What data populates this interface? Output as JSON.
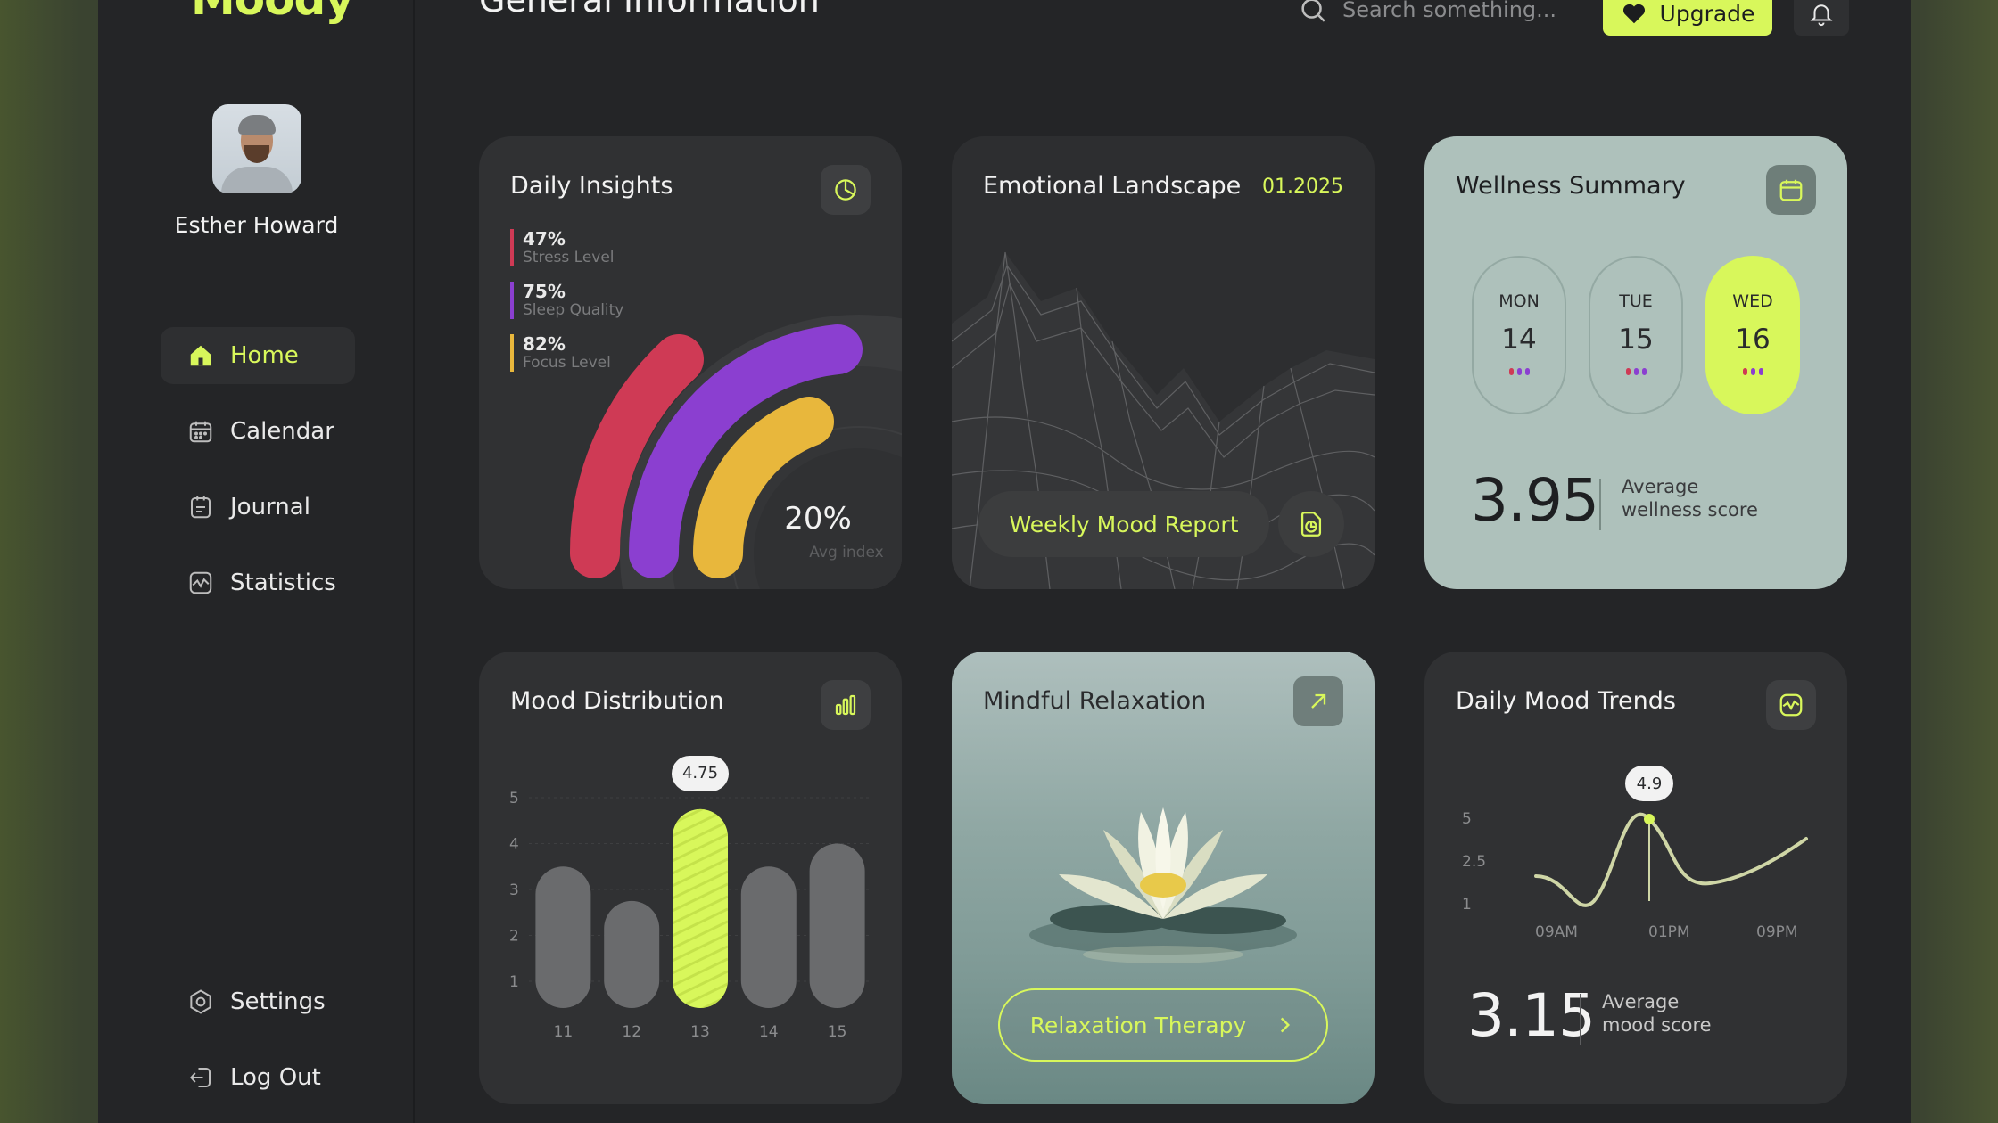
{
  "app": {
    "logo": "Moody",
    "page_title": "General Information"
  },
  "user": {
    "name": "Esther Howard"
  },
  "sidebar": {
    "items": [
      {
        "label": "Home",
        "icon": "home-icon"
      },
      {
        "label": "Calendar",
        "icon": "calendar-icon"
      },
      {
        "label": "Journal",
        "icon": "journal-icon"
      },
      {
        "label": "Statistics",
        "icon": "statistics-icon"
      }
    ],
    "settings": "Settings",
    "logout": "Log Out"
  },
  "header": {
    "search_placeholder": "Search something...",
    "upgrade_label": "Upgrade"
  },
  "daily_insights": {
    "title": "Daily Insights",
    "stats": [
      {
        "value": "47%",
        "label": "Stress Level",
        "color": "#cf3a55"
      },
      {
        "value": "75%",
        "label": "Sleep Quality",
        "color": "#8b3fd0"
      },
      {
        "value": "82%",
        "label": "Focus Level",
        "color": "#e8b73c"
      }
    ],
    "center_value": "20%",
    "center_label": "Avg index"
  },
  "emotional_landscape": {
    "title": "Emotional Landscape",
    "date": "01.2025",
    "button": "Weekly Mood Report"
  },
  "wellness_summary": {
    "title": "Wellness Summary",
    "days": [
      {
        "name": "MON",
        "date": "14",
        "selected": false
      },
      {
        "name": "TUE",
        "date": "15",
        "selected": false
      },
      {
        "name": "WED",
        "date": "16",
        "selected": true
      }
    ],
    "score": "3.95",
    "score_label_1": "Average",
    "score_label_2": "wellness score"
  },
  "mood_distribution": {
    "title": "Mood Distribution",
    "tooltip": "4.75",
    "y_ticks": [
      "5",
      "4",
      "3",
      "2",
      "1"
    ],
    "chart_data": {
      "type": "bar",
      "categories": [
        "11",
        "12",
        "13",
        "14",
        "15"
      ],
      "values": [
        3.5,
        2.75,
        4.75,
        3.5,
        4.0
      ],
      "ylim": [
        1,
        5
      ],
      "highlight": "13"
    }
  },
  "mindful_relaxation": {
    "title": "Mindful Relaxation",
    "button": "Relaxation Therapy"
  },
  "daily_mood_trends": {
    "title": "Daily Mood Trends",
    "tooltip": "4.9",
    "y_ticks": [
      "5",
      "2.5",
      "1"
    ],
    "x_ticks": [
      "09AM",
      "01PM",
      "09PM"
    ],
    "score": "3.15",
    "score_label_1": "Average",
    "score_label_2": "mood score"
  },
  "colors": {
    "accent": "#d8f75b",
    "red": "#cf3a55",
    "purple": "#8b3fd0",
    "yellow": "#e8b73c"
  }
}
